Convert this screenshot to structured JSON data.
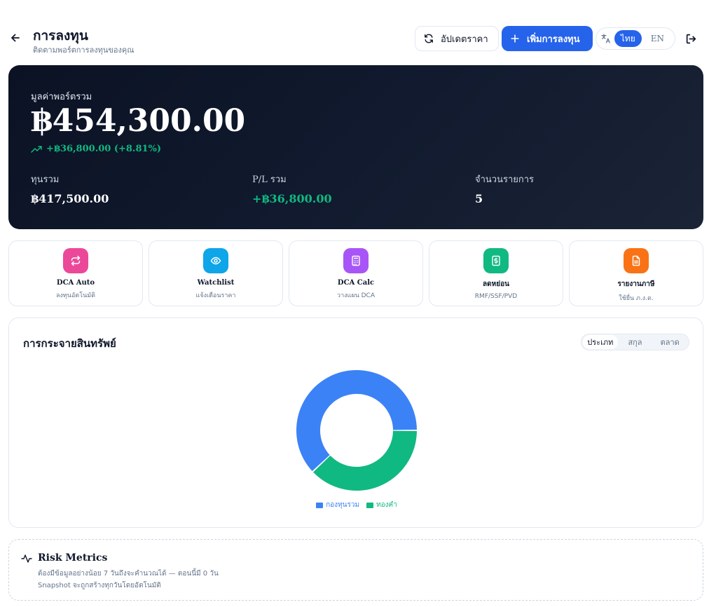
{
  "header": {
    "title": "การลงทุน",
    "subtitle": "ติดตามพอร์ตการลงทุนของคุณ",
    "update_label": "อัปเดตราคา",
    "add_label": "เพิ่มการลงทุน",
    "lang_th": "ไทย",
    "lang_en": "EN",
    "accent": "#2563eb"
  },
  "portfolio": {
    "label": "มูลค่าพอร์ตรวม",
    "total": "฿454,300.00",
    "change": "+฿36,800.00 (+8.81%)",
    "stats": [
      {
        "label": "ทุนรวม",
        "value": "฿417,500.00"
      },
      {
        "label": "P/L รวม",
        "value": "+฿36,800.00"
      },
      {
        "label": "จำนวนรายการ",
        "value": "5"
      }
    ]
  },
  "quick_actions": [
    {
      "title": "DCA Auto",
      "sub": "ลงทุนอัตโนมัติ",
      "icon": "repeat-icon",
      "color": "#ec4899"
    },
    {
      "title": "Watchlist",
      "sub": "แจ้งเตือนราคา",
      "icon": "eye-icon",
      "color": "#0ea5e9"
    },
    {
      "title": "DCA Calc",
      "sub": "วางแผน DCA",
      "icon": "calculator-icon",
      "color": "#a855f7"
    },
    {
      "title": "ลดหย่อน",
      "sub": "RMF/SSF/PVD",
      "icon": "receipt-icon",
      "color": "#10b981"
    },
    {
      "title": "รายงานภาษี",
      "sub": "ใช้ยื่น ภ.ง.ด.",
      "icon": "document-icon",
      "color": "#f97316"
    }
  ],
  "allocation": {
    "title": "การกระจายสินทรัพย์",
    "tabs": [
      "ประเภท",
      "สกุล",
      "ตลาด"
    ],
    "active_tab": 0
  },
  "chart_data": {
    "type": "pie",
    "categories": [
      "กองทุนรวม",
      "ทองคำ"
    ],
    "values": [
      62,
      38
    ],
    "colors": [
      "#3b82f6",
      "#10b981"
    ],
    "legend": "bottom"
  },
  "risk": {
    "title": "Risk Metrics",
    "line1": "ต้องมีข้อมูลอย่างน้อย 7 วันถึงจะคำนวณได้ — ตอนนี้มี 0 วัน",
    "line2": "Snapshot จะถูกสร้างทุกวันโดยอัตโนมัติ"
  }
}
